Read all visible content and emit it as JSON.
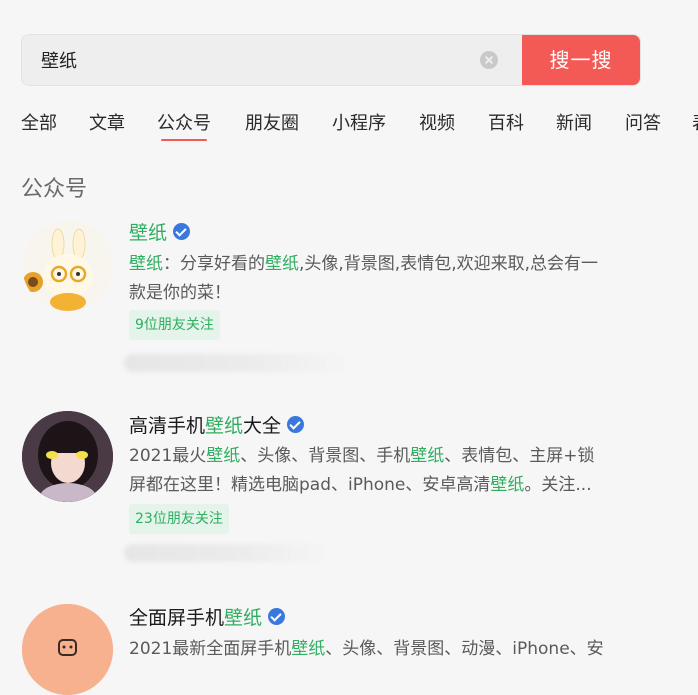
{
  "search": {
    "query": "壁纸",
    "button_label": "搜一搜"
  },
  "tabs": [
    {
      "label": "全部",
      "active": false
    },
    {
      "label": "文章",
      "active": false
    },
    {
      "label": "公众号",
      "active": true
    },
    {
      "label": "朋友圈",
      "active": false
    },
    {
      "label": "小程序",
      "active": false
    },
    {
      "label": "视频",
      "active": false
    },
    {
      "label": "百科",
      "active": false
    },
    {
      "label": "新闻",
      "active": false
    },
    {
      "label": "问答",
      "active": false
    },
    {
      "label": "表",
      "active": false
    }
  ],
  "section_title": "公众号",
  "accounts": [
    {
      "name_prefix": "",
      "name_highlight": "壁纸",
      "name_suffix": "",
      "desc_1_hl": "壁纸",
      "desc_1_a": "：分享好看的",
      "desc_1_hl2": "壁纸",
      "desc_1_b": ",头像,背景图,表情包,欢迎来取,总会有一",
      "desc_2": "款是你的菜！",
      "friends": "9位朋友关注"
    },
    {
      "name_prefix": "高清手机",
      "name_highlight": "壁纸",
      "name_suffix": "大全",
      "desc_1_a": "2021最火",
      "desc_1_hl": "壁纸",
      "desc_1_b": "、头像、背景图、手机",
      "desc_1_hl2": "壁纸",
      "desc_1_c": "、表情包、主屏+锁",
      "desc_2_a": "屏都在这里！精选电脑pad、iPhone、安卓高清",
      "desc_2_hl": "壁纸",
      "desc_2_b": "。关注...",
      "friends": "23位朋友关注"
    },
    {
      "name_prefix": "全面屏手机",
      "name_highlight": "壁纸",
      "name_suffix": "",
      "desc_1_a": "2021最新全面屏手机",
      "desc_1_hl": "壁纸",
      "desc_1_b": "、头像、背景图、动漫、iPhone、安"
    }
  ],
  "colors": {
    "accent_red": "#f35a56",
    "highlight_green": "#2fae60",
    "verified_blue": "#3b78dd"
  }
}
